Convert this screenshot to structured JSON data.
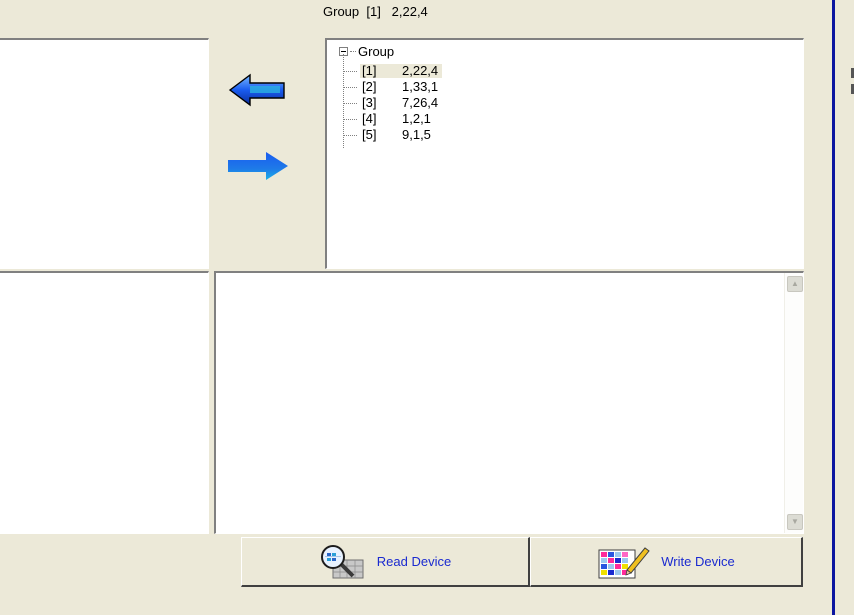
{
  "selection": {
    "label": "Group  [1]   2,22,4"
  },
  "tree": {
    "root": "Group",
    "items": [
      {
        "index": "[1]",
        "value": "2,22,4",
        "selected": true
      },
      {
        "index": "[2]",
        "value": "1,33,1",
        "selected": false
      },
      {
        "index": "[3]",
        "value": "7,26,4",
        "selected": false
      },
      {
        "index": "[4]",
        "value": "1,2,1",
        "selected": false
      },
      {
        "index": "[5]",
        "value": "9,1,5",
        "selected": false
      }
    ]
  },
  "buttons": {
    "read": {
      "label": "Read Device",
      "icon": "magnifier-grid-icon"
    },
    "write": {
      "label": "Write Device",
      "icon": "color-grid-pencil-icon"
    }
  },
  "colors": {
    "button_text": "#1a2ad0",
    "arrow_blue": "#1a5cf0",
    "frame": "#ece9d8",
    "edge": "#0b16a0"
  }
}
